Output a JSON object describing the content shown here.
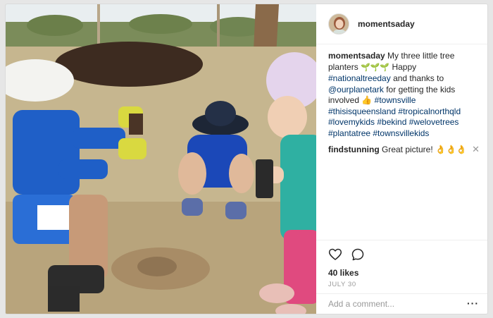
{
  "post": {
    "username": "momentsaday",
    "caption": {
      "username": "momentsaday",
      "text_before_icons": " My three little tree planters ",
      "sprout_icons": "🌱🌱🌱",
      "text_happy": " Happy ",
      "hashtag_1": "#nationaltreeday",
      "text_thanks": " and thanks to ",
      "mention": "@ourplanetark",
      "text_involved": " for getting the kids involved ",
      "thumb_icon": "👍",
      "hashtags": "#townsville #thisisqueensland #tropicalnorthqld #lovemykids #bekind #welovetrees #plantatree #townsvillekids"
    },
    "comment": {
      "username": "findstunning",
      "text": " Great picture! ",
      "emoji": "👌👌👌",
      "close_symbol": "✕"
    },
    "likes": "40 likes",
    "date": "JULY 30",
    "add_comment_placeholder": "Add a comment...",
    "more_symbol": "···"
  },
  "icons": {
    "heart": "heart-icon",
    "comment": "comment-icon",
    "more": "more-options-icon"
  },
  "colors": {
    "link": "#003569",
    "text": "#262626",
    "muted": "#999999",
    "border": "#efefef"
  }
}
